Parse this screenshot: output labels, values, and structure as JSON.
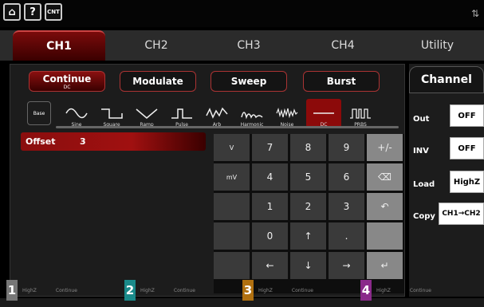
{
  "top_icons": [
    "home-icon",
    "help-icon",
    "counter-icon"
  ],
  "top_labels": {
    "help": "?",
    "counter": "CNT"
  },
  "tabs": [
    "CH1",
    "CH2",
    "CH3",
    "CH4",
    "Utility"
  ],
  "modes": [
    {
      "label": "Continue",
      "sub": "DC"
    },
    {
      "label": "Modulate",
      "sub": ""
    },
    {
      "label": "Sweep",
      "sub": ""
    },
    {
      "label": "Burst",
      "sub": ""
    }
  ],
  "base": "Base",
  "waves": [
    "Sine",
    "Square",
    "Ramp",
    "Pulse",
    "Arb",
    "Harmonic",
    "Noise",
    "DC",
    "PRBS"
  ],
  "param": {
    "label": "Offset",
    "value": "3"
  },
  "keys": [
    [
      "V",
      "7",
      "8",
      "9",
      "+/-"
    ],
    [
      "mV",
      "4",
      "5",
      "6",
      "⌫"
    ],
    [
      "",
      "1",
      "2",
      "3",
      "↶"
    ],
    [
      "",
      "0",
      "↑",
      ".",
      ""
    ],
    [
      "",
      "←",
      "↓",
      "→",
      "↵"
    ]
  ],
  "channel": {
    "title": "Channel",
    "out_label": "Out",
    "out_value": "OFF",
    "inv_label": "INV",
    "inv_value": "OFF",
    "load_label": "Load",
    "load_value": "HighZ",
    "copy_label": "Copy",
    "copy_value": "CH1→CH2"
  },
  "bottom": [
    {
      "num": "1",
      "load": "HighZ",
      "mode": "Continue",
      "color": "#777"
    },
    {
      "num": "2",
      "load": "HighZ",
      "mode": "Continue",
      "color": "#1a8a8a"
    },
    {
      "num": "3",
      "load": "HighZ",
      "mode": "Continue",
      "color": "#b07010"
    },
    {
      "num": "4",
      "load": "HighZ",
      "mode": "Continue",
      "color": "#8a2a8a"
    }
  ]
}
